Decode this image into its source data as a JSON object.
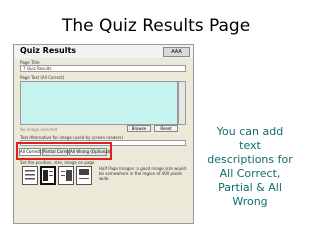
{
  "slide_title": "The Quiz Results Page",
  "editor": {
    "header_title": "Quiz Results",
    "aaa_button": "AAA",
    "page_title_label": "Page Title",
    "page_title_value": "7 Quiz Results",
    "page_text_label": "Page Text (All Correct)",
    "no_image_text": "No image selected",
    "browse_label": "Browse",
    "reset_label": "Reset",
    "alt_label": "Text Alternative for image (used by screen readers)",
    "tabs": [
      "All Correct",
      "Partial Correct",
      "All Wrong (Optional)"
    ],
    "layout_label": "Set the position, size, image on page",
    "hint_text": "Half Page Images: a good image size would be somewhere in the region of 400 pixels wide."
  },
  "note_text": "You can add text descriptions for All Correct, Partial & All Wrong",
  "colors": {
    "note": "#0f6e6e",
    "highlight": "#e02020",
    "text_area": "#c7f3ef"
  }
}
